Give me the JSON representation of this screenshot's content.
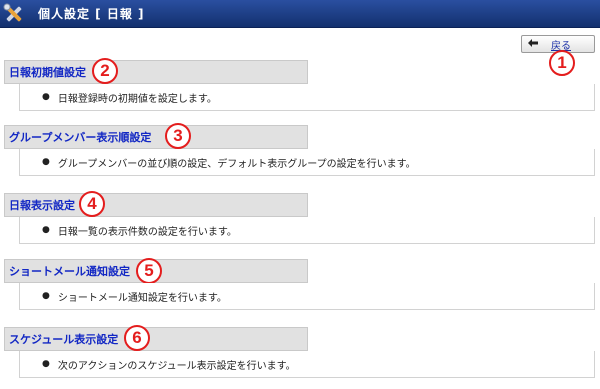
{
  "window": {
    "title": "個人設定 [ 日報 ]",
    "icon": "tools-icon"
  },
  "toolbar": {
    "back_label": "戻る",
    "back_icon": "back-arrow-icon"
  },
  "sections": [
    {
      "title": "日報初期値設定",
      "description": "日報登録時の初期値を設定します。",
      "badge": "2"
    },
    {
      "title": "グループメンバー表示順設定",
      "description": "グループメンバーの並び順の設定、デフォルト表示グループの設定を行います。",
      "badge": "3"
    },
    {
      "title": "日報表示設定",
      "description": "日報一覧の表示件数の設定を行います。",
      "badge": "4"
    },
    {
      "title": "ショートメール通知設定",
      "description": "ショートメール通知設定を行います。",
      "badge": "5"
    },
    {
      "title": "スケジュール表示設定",
      "description": "次のアクションのスケジュール表示設定を行います。",
      "badge": "6"
    }
  ],
  "back_badge": "1",
  "colors": {
    "titlebar": "#13306e",
    "link": "#1227c4",
    "badge": "#e41d1d",
    "header_bg": "#e1e1e1"
  }
}
